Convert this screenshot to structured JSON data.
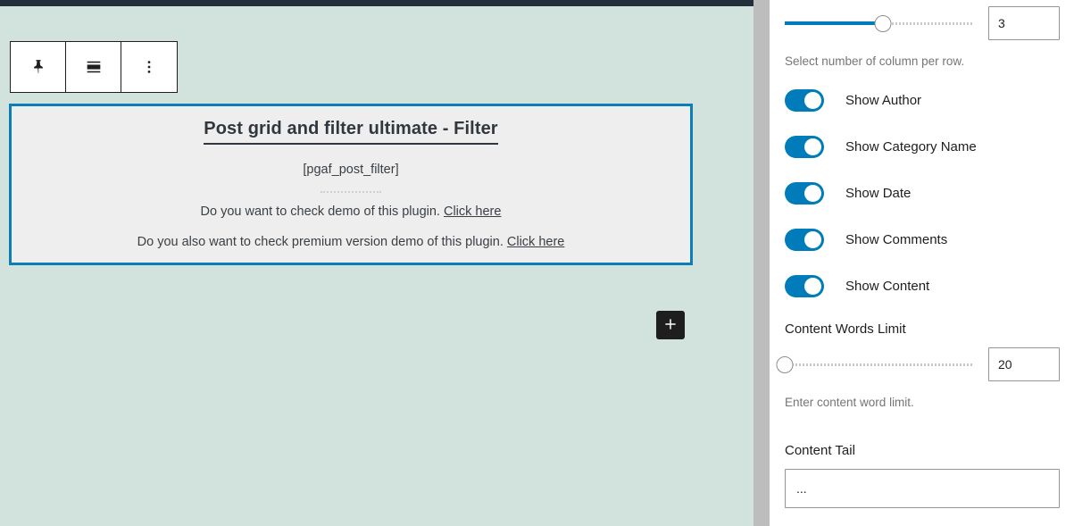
{
  "editor": {
    "block_toolbar": {
      "pin_label": "pin-block",
      "align_label": "change-alignment",
      "more_label": "more-options"
    },
    "block": {
      "title": "Post grid and filter ultimate - Filter",
      "shortcode": "[pgaf_post_filter]",
      "demo_line": "Do you want to check demo of this plugin.",
      "demo_link": "Click here",
      "premium_line": "Do you also want to check premium version demo of this plugin.",
      "premium_link": "Click here"
    },
    "inserter_label": "+",
    "colors": {
      "canvas_bg": "#d2e2dc",
      "block_bg": "#eeeeee",
      "block_border": "#0b7eb8",
      "admin_bar": "#23303c",
      "inserter_bg": "#1e1e1e"
    }
  },
  "sidebar": {
    "columns": {
      "value": "3",
      "slider_percent": 52,
      "help": "Select number of column per row."
    },
    "toggles": [
      {
        "label": "Show Author",
        "on": true
      },
      {
        "label": "Show Category Name",
        "on": true
      },
      {
        "label": "Show Date",
        "on": true
      },
      {
        "label": "Show Comments",
        "on": true
      },
      {
        "label": "Show Content",
        "on": true
      }
    ],
    "content_words_limit": {
      "label": "Content Words Limit",
      "value": "20",
      "slider_percent": 0,
      "help": "Enter content word limit."
    },
    "content_tail": {
      "label": "Content Tail",
      "value": "..."
    },
    "accent_color": "#007cba"
  }
}
